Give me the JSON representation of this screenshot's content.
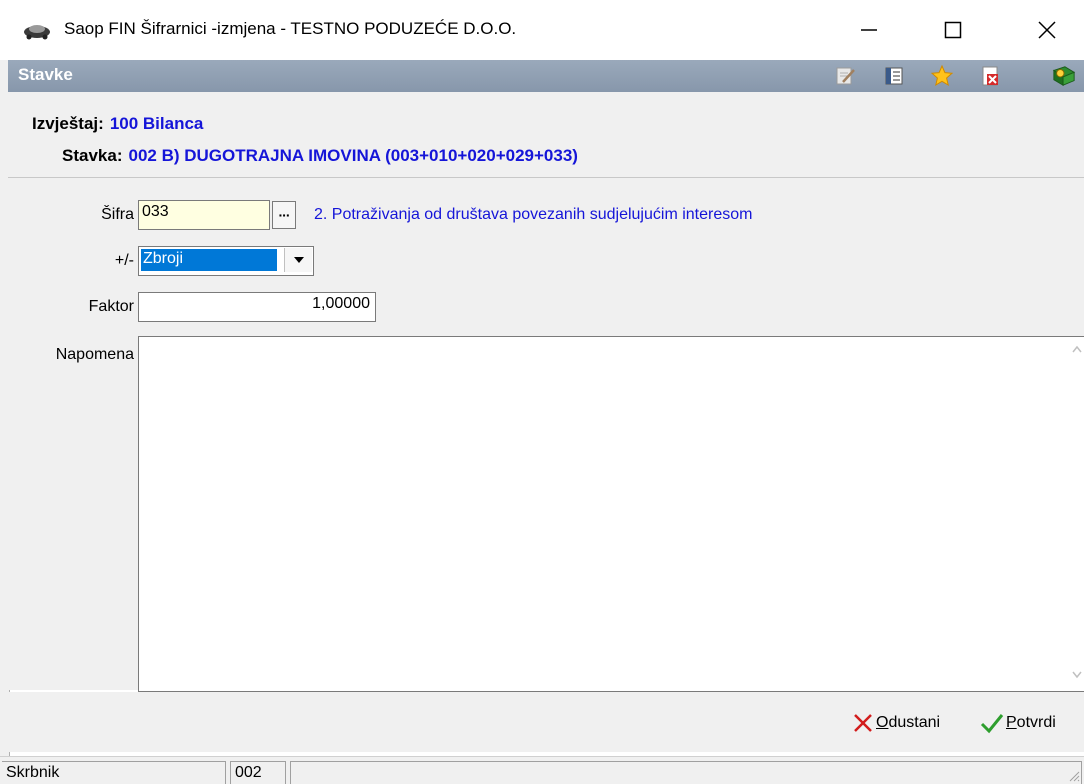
{
  "window": {
    "title": "Saop FIN Šifrarnici -izmjena  - TESTNO PODUZEĆE D.O.O.",
    "app_icon": "car-icon",
    "controls": [
      "minimize-icon",
      "maximize-icon",
      "close-icon"
    ]
  },
  "panel": {
    "title": "Stavke",
    "toolbar_icons": [
      "edit-icon",
      "list-icon",
      "star-icon",
      "delete-icon",
      "help-icon"
    ]
  },
  "info": {
    "izvjestaj_label": "Izvještaj:",
    "izvjestaj_value": "100 Bilanca",
    "stavka_label": "Stavka:",
    "stavka_value": "002 B)  DUGOTRAJNA IMOVINA (003+010+020+029+033)"
  },
  "form": {
    "sifra_label": "Šifra",
    "sifra_value": "033",
    "sifra_lookup": "···",
    "sifra_description": "2. Potraživanja od društava povezanih sudjelujućim interesom",
    "sign_label": "+/-",
    "sign_value": "Zbroji",
    "faktor_label": "Faktor",
    "faktor_value": "1,00000",
    "napomena_label": "Napomena",
    "napomena_value": ""
  },
  "actions": {
    "cancel_accel": "O",
    "cancel_rest": "dustani",
    "confirm_accel": "P",
    "confirm_rest": "otvrdi"
  },
  "status": {
    "user_label": "Skrbnik",
    "user_value": "002"
  },
  "colors": {
    "accent_blue": "#1515d8",
    "header_gray": "#8797ab",
    "selection": "#0078d7",
    "cancel_red": "#d21c1c",
    "confirm_green": "#2e9e2e"
  }
}
